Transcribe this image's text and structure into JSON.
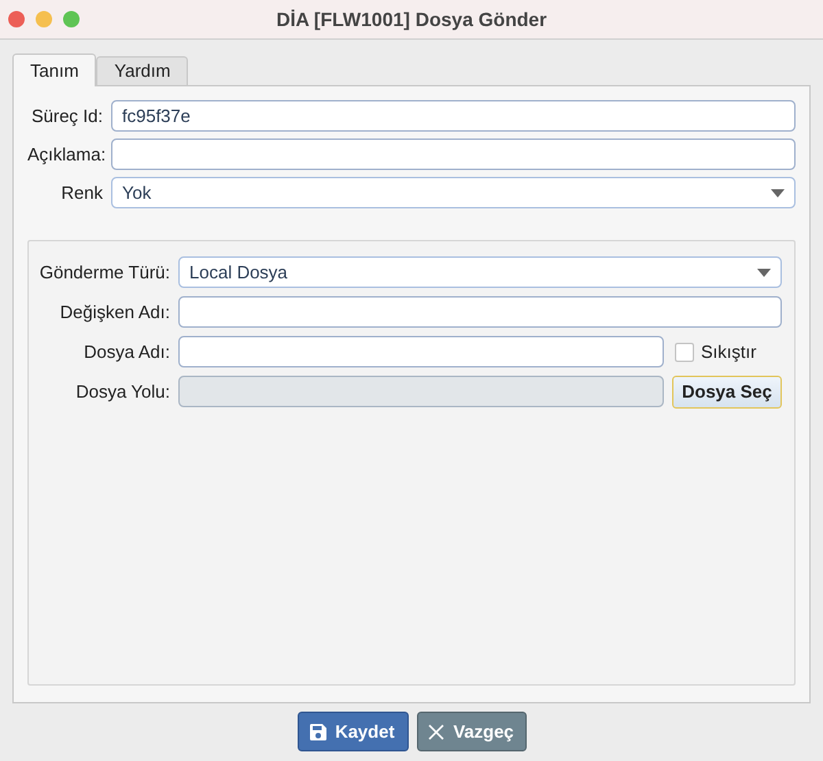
{
  "window": {
    "title": "DİA [FLW1001] Dosya Gönder"
  },
  "tabs": [
    {
      "label": "Tanım",
      "selected": true
    },
    {
      "label": "Yardım",
      "selected": false
    }
  ],
  "fields": [
    {
      "label": "Süreç Id:",
      "kind": "text",
      "value": "fc95f37e"
    },
    {
      "label": "Açıklama:",
      "kind": "text"
    },
    {
      "label": "Renk",
      "kind": "select",
      "value": "Yok"
    }
  ],
  "group_fields": [
    {
      "label": "Gönderme Türü:",
      "kind": "select",
      "value": "Local Dosya",
      "disabled": false
    },
    {
      "label": "Değişken Adı:",
      "kind": "text",
      "disabled": false
    },
    {
      "label": "Dosya Adı:",
      "kind": "text",
      "disabled": false,
      "checkbox": {
        "label": "Sıkıştır",
        "checked": false
      }
    },
    {
      "label": "Dosya Yolu:",
      "kind": "text",
      "disabled": true,
      "button": "Dosya Seç"
    }
  ],
  "buttons": [
    {
      "label": "Kaydet",
      "kind": "save"
    },
    {
      "label": "Vazgeç",
      "kind": "cancel"
    }
  ]
}
